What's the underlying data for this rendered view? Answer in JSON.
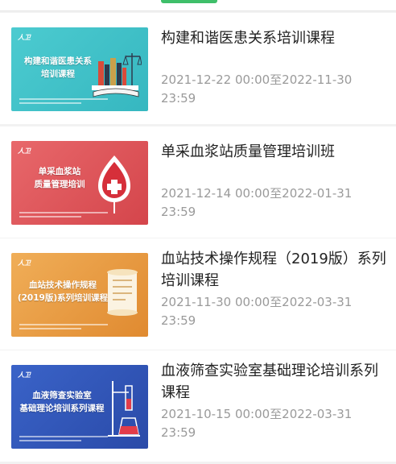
{
  "courses": [
    {
      "title": "构建和谐医患关系培训课程",
      "date": "2021-12-22 00:00至2022-11-30 23:59",
      "thumb_title": "构建和谐医患关系\n培训课程",
      "thumb_logo": "人卫",
      "thumb_icon": "books-scale-icon",
      "thumb_color": "#3ec0c6"
    },
    {
      "title": "单采血浆站质量管理培训班",
      "date": "2021-12-14 00:00至2022-01-31 23:59",
      "thumb_title": "单采血浆站\n质量管理培训",
      "thumb_logo": "人卫",
      "thumb_icon": "blood-bag-icon",
      "thumb_color": "#d9454a"
    },
    {
      "title": "血站技术操作规程（2019版）系列培训课程",
      "date": "2021-11-30 00:00至2022-03-31 23:59",
      "thumb_title": "血站技术操作规程\n(2019版)系列培训课程",
      "thumb_logo": "人卫",
      "thumb_icon": "scroll-icon",
      "thumb_color": "#e89a3c"
    },
    {
      "title": "血液筛查实验室基础理论培训系列课程",
      "date": "2021-10-15 00:00至2022-03-31 23:59",
      "thumb_title": "血液筛查实验室\n基础理论培训系列课程",
      "thumb_logo": "人卫",
      "thumb_icon": "lab-equipment-icon",
      "thumb_color": "#2f55b8"
    }
  ]
}
